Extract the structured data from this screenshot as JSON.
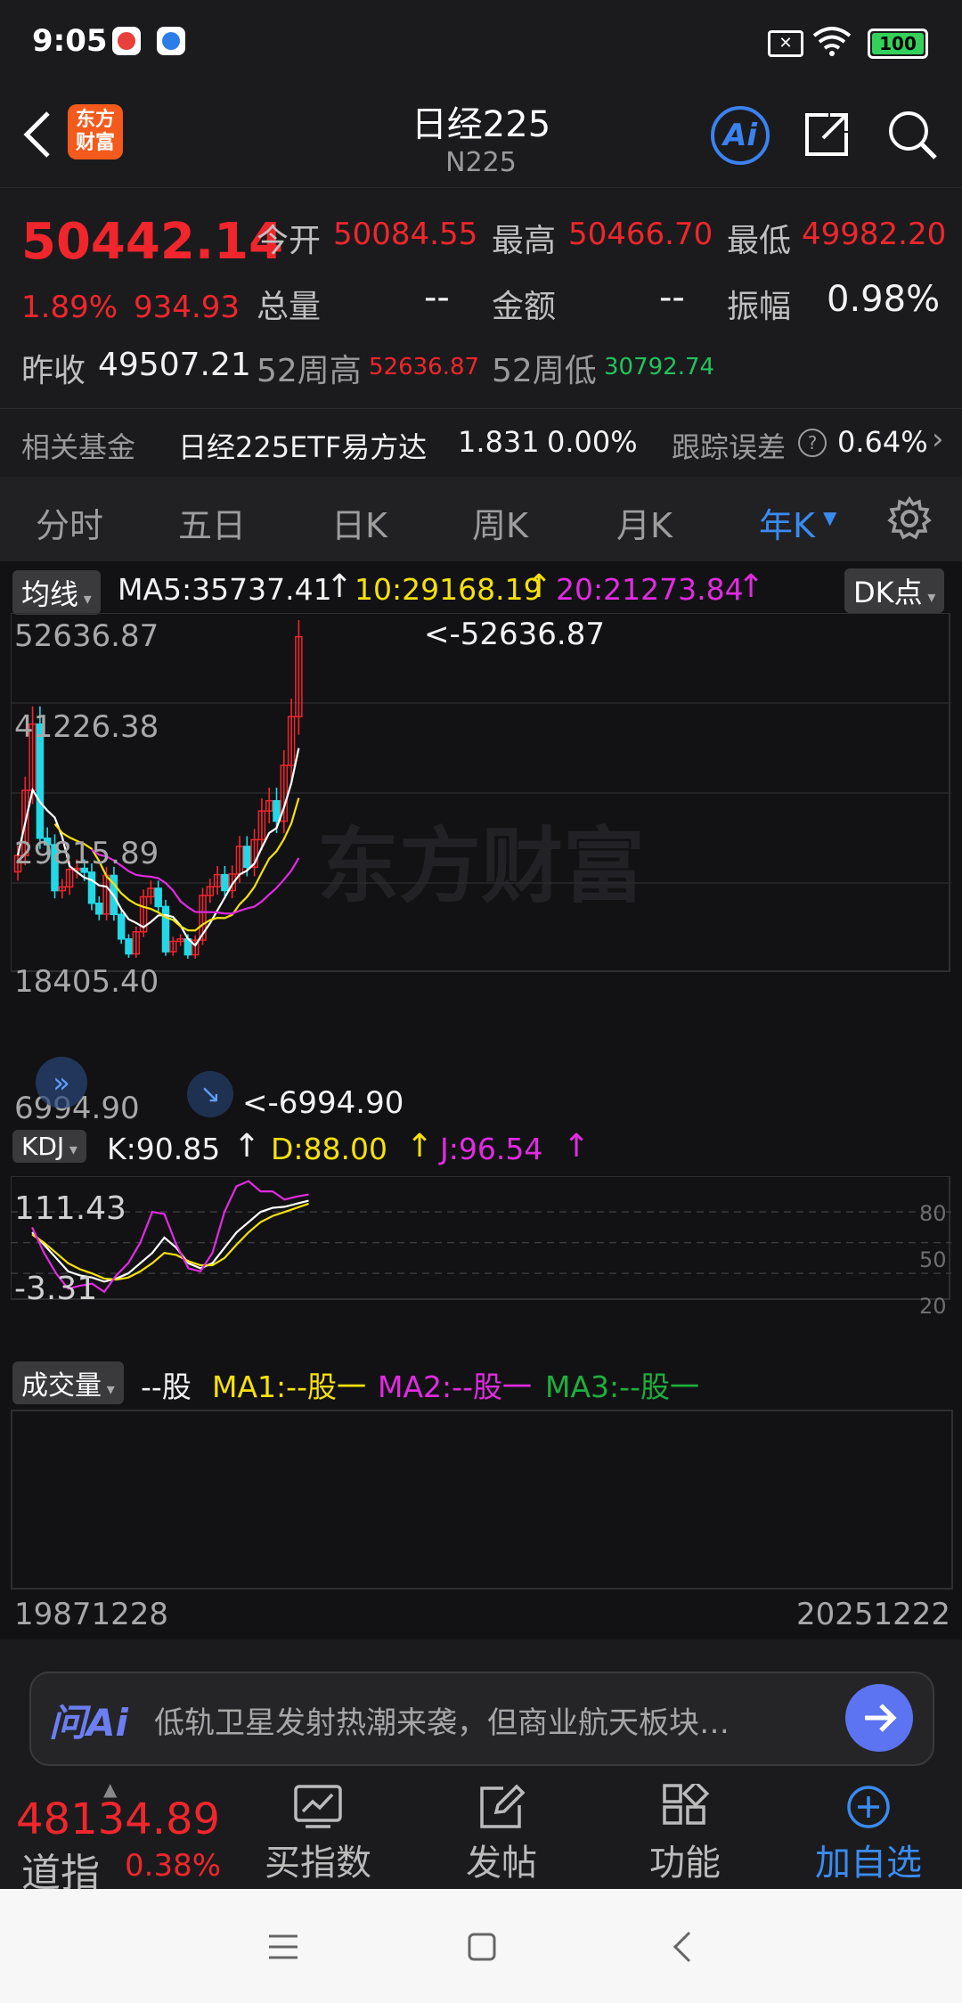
{
  "status_bar": {
    "time": "9:05",
    "battery": "100"
  },
  "header": {
    "title": "日经225",
    "code": "N225",
    "logo_line1": "东方",
    "logo_line2": "财富",
    "ai_label": "Ai"
  },
  "quote": {
    "price": "50442.14",
    "change_pct": "1.89%",
    "change_abs": "934.93",
    "open_label": "今开",
    "open": "50084.55",
    "high_label": "最高",
    "high": "50466.70",
    "low_label": "最低",
    "low": "49982.20",
    "volume_label": "总量",
    "volume": "--",
    "amount_label": "金额",
    "amount": "--",
    "amplitude_label": "振幅",
    "amplitude": "0.98%",
    "prev_close_label": "昨收",
    "prev_close": "49507.21",
    "w52_high_label": "52周高",
    "w52_high": "52636.87",
    "w52_low_label": "52周低",
    "w52_low": "30792.74"
  },
  "fund_bar": {
    "label": "相关基金",
    "fund_name": "日经225ETF易方达",
    "fund_price": "1.831",
    "fund_change": "0.00%",
    "tracking_label": "跟踪误差",
    "tracking_value": "0.64%"
  },
  "tabs": [
    "分时",
    "五日",
    "日K",
    "周K",
    "月K",
    "年K"
  ],
  "active_tab": "年K",
  "ma_bar": {
    "selector": "均线",
    "ma5": "MA5:35737.41",
    "ma10": "10:29168.19",
    "ma20": "20:21273.84",
    "dk_button": "DK点"
  },
  "chart": {
    "y_labels": [
      "52636.87",
      "41226.38",
      "29815.89",
      "18405.40",
      "6994.90"
    ],
    "max_marker": "<-52636.87",
    "min_marker": "<-6994.90",
    "watermark": "东方财富",
    "x_start": "19871228",
    "x_end": "20251222"
  },
  "chart_data": {
    "type": "candlestick",
    "title": "",
    "ylim": [
      6994.9,
      52636.87
    ],
    "x_range": [
      "19871228",
      "20251222"
    ],
    "series": [
      {
        "name": "MA5",
        "last": 35737.41
      },
      {
        "name": "10",
        "last": 29168.19
      },
      {
        "name": "20",
        "last": 21273.84
      }
    ],
    "closes": [
      21564,
      30159,
      38916,
      23849,
      22984,
      16925,
      17417,
      19723,
      19868,
      19361,
      15259,
      13842,
      18934,
      13785,
      10543,
      8579,
      11489,
      16111,
      17226,
      14827,
      8860,
      10229,
      10546,
      8455,
      10395,
      16291,
      17451,
      19034,
      16940,
      19114,
      22765,
      20015,
      23657,
      27444,
      28792,
      26095,
      33464,
      39894,
      50442
    ]
  },
  "kdj": {
    "selector": "KDJ",
    "k": "K:90.85",
    "d": "D:88.00",
    "j": "J:96.54",
    "top": "111.43",
    "bottom": "-3.31",
    "levels": [
      "80",
      "50",
      "20"
    ]
  },
  "kdj_data": {
    "ylim": [
      -3.31,
      111.43
    ],
    "K": [
      60,
      48,
      35,
      22,
      18,
      16,
      12,
      15,
      20,
      30,
      40,
      55,
      45,
      30,
      25,
      30,
      45,
      60,
      70,
      80,
      84,
      85,
      88,
      91
    ],
    "D": [
      58,
      50,
      40,
      30,
      24,
      20,
      15,
      14,
      16,
      22,
      30,
      40,
      38,
      32,
      28,
      28,
      35,
      48,
      60,
      70,
      76,
      80,
      84,
      88
    ],
    "J": [
      65,
      40,
      20,
      5,
      8,
      10,
      2,
      18,
      30,
      50,
      80,
      78,
      48,
      25,
      22,
      40,
      80,
      105,
      110,
      100,
      100,
      92,
      95,
      97
    ]
  },
  "volume": {
    "selector": "成交量",
    "unit": "--股",
    "ma1": "MA1:--股一",
    "ma2": "MA2:--股一",
    "ma3": "MA3:--股一"
  },
  "ai_bar": {
    "label": "问Ai",
    "text": "低轨卫星发射热潮来袭，但商业航天板块…"
  },
  "bottom_nav": {
    "index_price": "48134.89",
    "index_name": "道指",
    "index_change": "0.38%",
    "buy_index": "买指数",
    "post": "发帖",
    "function": "功能",
    "add_watch": "加自选"
  },
  "colors": {
    "red": "#f0262c",
    "green": "#22c35e",
    "yellow": "#f6e10c",
    "magenta": "#e12be1",
    "blue": "#3a8bf0"
  }
}
